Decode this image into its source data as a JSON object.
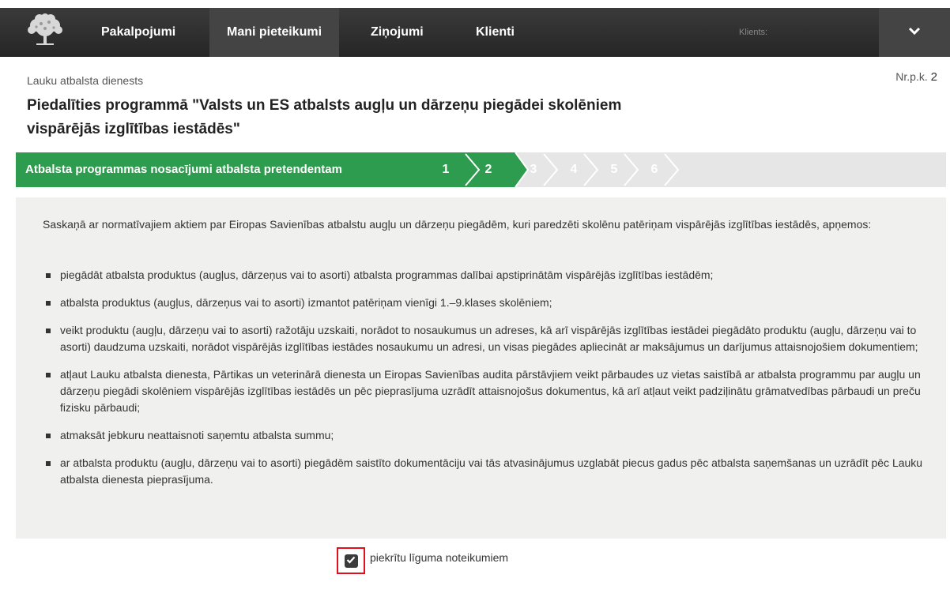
{
  "nav": {
    "items": [
      {
        "label": "Pakalpojumi",
        "active": false
      },
      {
        "label": "Mani pieteikumi",
        "active": true
      },
      {
        "label": "Ziņojumi",
        "active": false
      },
      {
        "label": "Klienti",
        "active": false
      }
    ],
    "client_label": "Klients:"
  },
  "header": {
    "service": "Lauku atbalsta dienests",
    "nrpk_label": "Nr.p.k.",
    "nrpk_value": "2",
    "title_line1": "Piedalīties programmā \"Valsts un ES atbalsts augļu un dārzeņu piegādei skolēniem",
    "title_line2": "vispārējās izglītības iestādēs\""
  },
  "steps": {
    "title": "Atbalsta programmas nosacījumi atbalsta pretendentam",
    "items": [
      "1",
      "2",
      "3",
      "4",
      "5",
      "6"
    ],
    "current": "2"
  },
  "content": {
    "intro": "Saskaņā ar normatīvajiem aktiem par Eiropas Savienības atbalstu augļu un dārzeņu piegādēm, kuri paredzēti skolēnu patēriņam vispārējās izglītības iestādēs, apņemos:",
    "bullets": [
      "piegādāt atbalsta produktus (augļus, dārzeņus vai to asorti) atbalsta programmas dalībai apstiprinātām vispārējās izglītības iestādēm;",
      "atbalsta produktus (augļus, dārzeņus vai to asorti) izmantot patēriņam vienīgi 1.–9.klases skolēniem;",
      "veikt produktu (augļu, dārzeņu vai to asorti) ražotāju uzskaiti, norādot to nosaukumus un adreses, kā arī vispārējās izglītības iestādei piegādāto produktu (augļu, dārzeņu vai to asorti) daudzuma uzskaiti, norādot vispārējās izglītības iestādes nosaukumu un adresi, un visas piegādes apliecināt ar maksājumus un darījumus attaisnojošiem dokumentiem;",
      "atļaut Lauku atbalsta dienesta, Pārtikas un veterinārā dienesta un Eiropas Savienības audita pārstāvjiem veikt pārbaudes uz vietas saistībā ar atbalsta programmu par augļu un dārzeņu piegādi skolēniem vispārējās izglītības iestādēs un pēc pieprasījuma uzrādīt attaisnojošus dokumentus, kā arī atļaut veikt padziļinātu grāmatvedības pārbaudi un preču fizisku pārbaudi;",
      "atmaksāt jebkuru neattaisnoti saņemtu atbalsta summu;",
      "ar atbalsta produktu (augļu, dārzeņu vai to asorti) piegādēm saistīto dokumentāciju vai tās atvasinājumus uzglabāt piecus gadus pēc atbalsta saņemšanas un uzrādīt pēc Lauku atbalsta dienesta pieprasījuma."
    ]
  },
  "agreement": {
    "label": "piekrītu līguma noteikumiem",
    "checked": true
  },
  "colors": {
    "nav_bg": "#2e2e2e",
    "steps_green": "#2e9c4e",
    "steps_gray": "#e6e6e6",
    "panel_bg": "#f0f0ee",
    "highlight_red": "#e0101e"
  },
  "icons": {
    "logo": "oak-tree-logo-icon",
    "chevron": "chevron-down-icon",
    "bullet": "square-bullet-icon",
    "checkbox": "checkmark-icon"
  }
}
